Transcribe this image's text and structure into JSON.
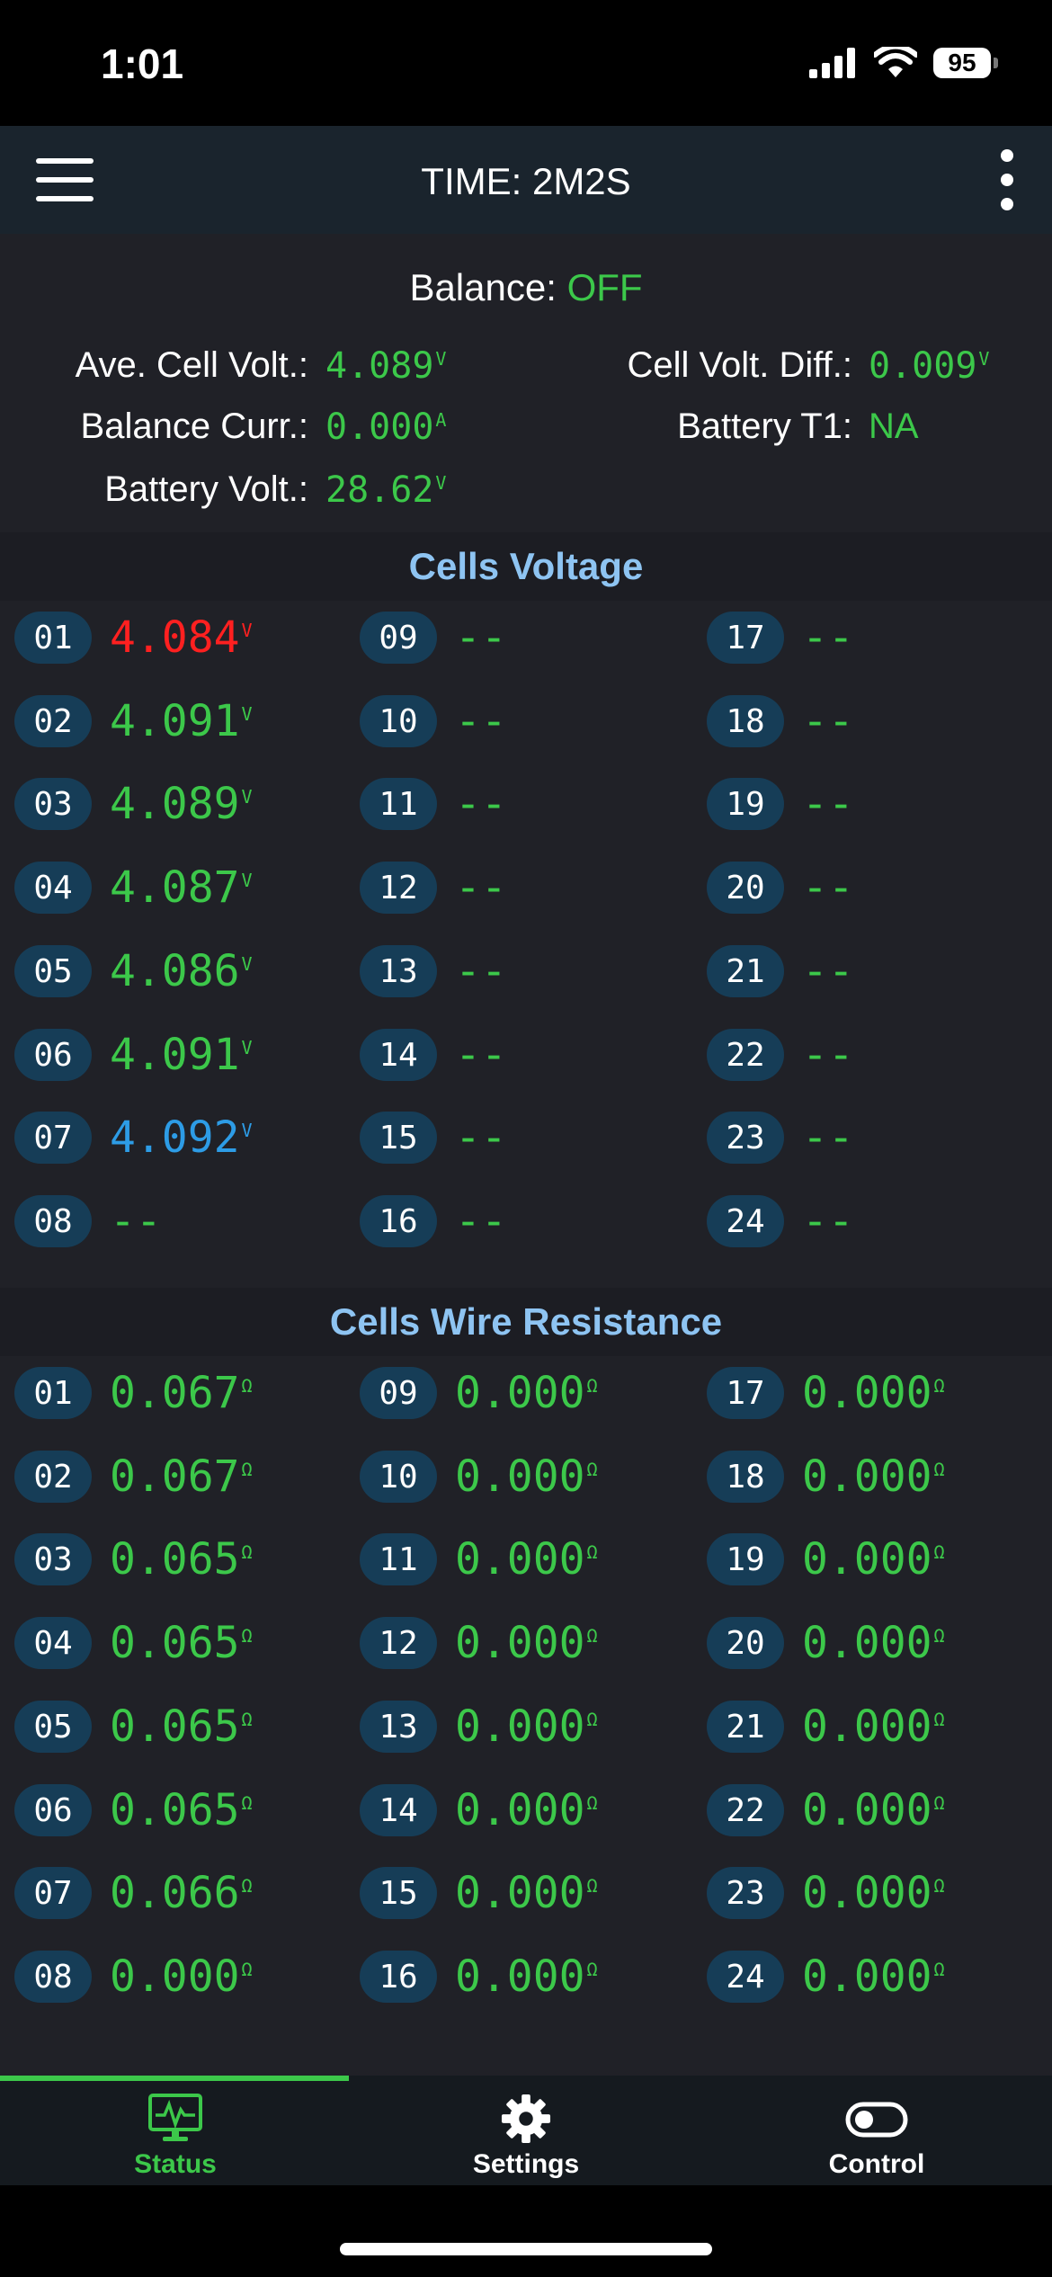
{
  "status_bar": {
    "time": "1:01",
    "battery": "95"
  },
  "app_bar": {
    "title": "TIME: 2M2S"
  },
  "summary": {
    "balance_label": "Balance:",
    "balance_value": "OFF",
    "ave_cell_volt_label": "Ave. Cell Volt.:",
    "ave_cell_volt_value": "4.089",
    "cell_volt_diff_label": "Cell Volt. Diff.:",
    "cell_volt_diff_value": "0.009",
    "balance_curr_label": "Balance Curr.:",
    "balance_curr_value": "0.000",
    "battery_t1_label": "Battery T1:",
    "battery_t1_value": "NA",
    "battery_volt_label": "Battery Volt.:",
    "battery_volt_value": "28.62",
    "unit_v": "V",
    "unit_a": "A"
  },
  "cells_voltage": {
    "title": "Cells Voltage",
    "unit": "V",
    "cells": [
      {
        "id": "01",
        "value": "4.084",
        "state": "low"
      },
      {
        "id": "02",
        "value": "4.091",
        "state": "normal"
      },
      {
        "id": "03",
        "value": "4.089",
        "state": "normal"
      },
      {
        "id": "04",
        "value": "4.087",
        "state": "normal"
      },
      {
        "id": "05",
        "value": "4.086",
        "state": "normal"
      },
      {
        "id": "06",
        "value": "4.091",
        "state": "normal"
      },
      {
        "id": "07",
        "value": "4.092",
        "state": "high"
      },
      {
        "id": "08",
        "value": "--",
        "state": "empty"
      },
      {
        "id": "09",
        "value": "--",
        "state": "empty"
      },
      {
        "id": "10",
        "value": "--",
        "state": "empty"
      },
      {
        "id": "11",
        "value": "--",
        "state": "empty"
      },
      {
        "id": "12",
        "value": "--",
        "state": "empty"
      },
      {
        "id": "13",
        "value": "--",
        "state": "empty"
      },
      {
        "id": "14",
        "value": "--",
        "state": "empty"
      },
      {
        "id": "15",
        "value": "--",
        "state": "empty"
      },
      {
        "id": "16",
        "value": "--",
        "state": "empty"
      },
      {
        "id": "17",
        "value": "--",
        "state": "empty"
      },
      {
        "id": "18",
        "value": "--",
        "state": "empty"
      },
      {
        "id": "19",
        "value": "--",
        "state": "empty"
      },
      {
        "id": "20",
        "value": "--",
        "state": "empty"
      },
      {
        "id": "21",
        "value": "--",
        "state": "empty"
      },
      {
        "id": "22",
        "value": "--",
        "state": "empty"
      },
      {
        "id": "23",
        "value": "--",
        "state": "empty"
      },
      {
        "id": "24",
        "value": "--",
        "state": "empty"
      }
    ]
  },
  "cells_resistance": {
    "title": "Cells Wire Resistance",
    "unit": "Ω",
    "cells": [
      {
        "id": "01",
        "value": "0.067"
      },
      {
        "id": "02",
        "value": "0.067"
      },
      {
        "id": "03",
        "value": "0.065"
      },
      {
        "id": "04",
        "value": "0.065"
      },
      {
        "id": "05",
        "value": "0.065"
      },
      {
        "id": "06",
        "value": "0.065"
      },
      {
        "id": "07",
        "value": "0.066"
      },
      {
        "id": "08",
        "value": "0.000"
      },
      {
        "id": "09",
        "value": "0.000"
      },
      {
        "id": "10",
        "value": "0.000"
      },
      {
        "id": "11",
        "value": "0.000"
      },
      {
        "id": "12",
        "value": "0.000"
      },
      {
        "id": "13",
        "value": "0.000"
      },
      {
        "id": "14",
        "value": "0.000"
      },
      {
        "id": "15",
        "value": "0.000"
      },
      {
        "id": "16",
        "value": "0.000"
      },
      {
        "id": "17",
        "value": "0.000"
      },
      {
        "id": "18",
        "value": "0.000"
      },
      {
        "id": "19",
        "value": "0.000"
      },
      {
        "id": "20",
        "value": "0.000"
      },
      {
        "id": "21",
        "value": "0.000"
      },
      {
        "id": "22",
        "value": "0.000"
      },
      {
        "id": "23",
        "value": "0.000"
      },
      {
        "id": "24",
        "value": "0.000"
      }
    ]
  },
  "tabs": [
    {
      "label": "Status",
      "icon": "monitor-pulse-icon",
      "active": true
    },
    {
      "label": "Settings",
      "icon": "gear-icon",
      "active": false
    },
    {
      "label": "Control",
      "icon": "toggle-icon",
      "active": false
    }
  ],
  "colors": {
    "accent_green": "#3cc84a",
    "low_red": "#ff2020",
    "high_blue": "#2d9ce6",
    "section_title": "#8ec4f2",
    "badge_bg": "#163d57"
  }
}
